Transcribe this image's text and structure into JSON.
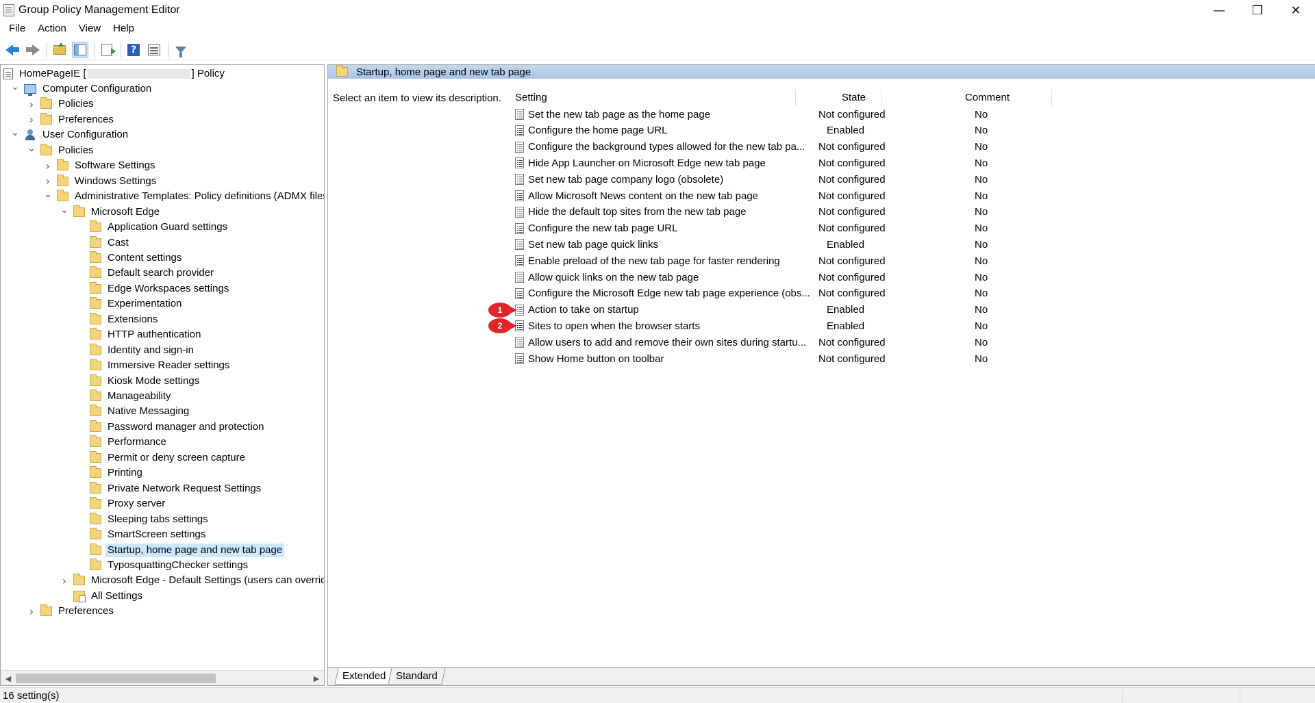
{
  "window": {
    "title": "Group Policy Management Editor",
    "controls": {
      "minimize": "—",
      "restore": "❐",
      "close": "✕"
    }
  },
  "menu": [
    "File",
    "Action",
    "View",
    "Help"
  ],
  "toolbar": {
    "icons": [
      "back-arrow-icon",
      "forward-arrow-icon",
      "up-folder-icon",
      "show-hide-tree-icon",
      "export-list-icon",
      "help-icon",
      "view-icon",
      "filter-icon"
    ],
    "help_glyph": "?"
  },
  "tree": {
    "root": {
      "prefix": "HomePageIE [",
      "suffix": "] Policy"
    },
    "items": [
      {
        "label": "Computer Configuration",
        "depth": 0,
        "expander": "open",
        "icon": "computer"
      },
      {
        "label": "Policies",
        "depth": 1,
        "expander": "closed",
        "icon": "folder"
      },
      {
        "label": "Preferences",
        "depth": 1,
        "expander": "closed",
        "icon": "folder"
      },
      {
        "label": "User Configuration",
        "depth": 0,
        "expander": "open",
        "icon": "user"
      },
      {
        "label": "Policies",
        "depth": 1,
        "expander": "open",
        "icon": "folder"
      },
      {
        "label": "Software Settings",
        "depth": 2,
        "expander": "closed",
        "icon": "folder"
      },
      {
        "label": "Windows Settings",
        "depth": 2,
        "expander": "closed",
        "icon": "folder"
      },
      {
        "label": "Administrative Templates: Policy definitions (ADMX files",
        "depth": 2,
        "expander": "open",
        "icon": "folder"
      },
      {
        "label": "Microsoft Edge",
        "depth": 3,
        "expander": "open",
        "icon": "folder"
      },
      {
        "label": "Application Guard settings",
        "depth": 4,
        "expander": "none",
        "icon": "folder"
      },
      {
        "label": "Cast",
        "depth": 4,
        "expander": "none",
        "icon": "folder"
      },
      {
        "label": "Content settings",
        "depth": 4,
        "expander": "none",
        "icon": "folder"
      },
      {
        "label": "Default search provider",
        "depth": 4,
        "expander": "none",
        "icon": "folder"
      },
      {
        "label": "Edge Workspaces settings",
        "depth": 4,
        "expander": "none",
        "icon": "folder"
      },
      {
        "label": "Experimentation",
        "depth": 4,
        "expander": "none",
        "icon": "folder"
      },
      {
        "label": "Extensions",
        "depth": 4,
        "expander": "none",
        "icon": "folder"
      },
      {
        "label": "HTTP authentication",
        "depth": 4,
        "expander": "none",
        "icon": "folder"
      },
      {
        "label": "Identity and sign-in",
        "depth": 4,
        "expander": "none",
        "icon": "folder"
      },
      {
        "label": "Immersive Reader settings",
        "depth": 4,
        "expander": "none",
        "icon": "folder"
      },
      {
        "label": "Kiosk Mode settings",
        "depth": 4,
        "expander": "none",
        "icon": "folder"
      },
      {
        "label": "Manageability",
        "depth": 4,
        "expander": "none",
        "icon": "folder"
      },
      {
        "label": "Native Messaging",
        "depth": 4,
        "expander": "none",
        "icon": "folder"
      },
      {
        "label": "Password manager and protection",
        "depth": 4,
        "expander": "none",
        "icon": "folder"
      },
      {
        "label": "Performance",
        "depth": 4,
        "expander": "none",
        "icon": "folder"
      },
      {
        "label": "Permit or deny screen capture",
        "depth": 4,
        "expander": "none",
        "icon": "folder"
      },
      {
        "label": "Printing",
        "depth": 4,
        "expander": "none",
        "icon": "folder"
      },
      {
        "label": "Private Network Request Settings",
        "depth": 4,
        "expander": "none",
        "icon": "folder"
      },
      {
        "label": "Proxy server",
        "depth": 4,
        "expander": "none",
        "icon": "folder"
      },
      {
        "label": "Sleeping tabs settings",
        "depth": 4,
        "expander": "none",
        "icon": "folder"
      },
      {
        "label": "SmartScreen settings",
        "depth": 4,
        "expander": "none",
        "icon": "folder"
      },
      {
        "label": "Startup, home page and new tab page",
        "depth": 4,
        "expander": "none",
        "icon": "folder",
        "selected": true
      },
      {
        "label": "TyposquattingChecker settings",
        "depth": 4,
        "expander": "none",
        "icon": "folder"
      },
      {
        "label": "Microsoft Edge - Default Settings (users can override",
        "depth": 3,
        "expander": "closed",
        "icon": "folder"
      },
      {
        "label": "All Settings",
        "depth": 3,
        "expander": "none",
        "icon": "allsettings"
      },
      {
        "label": "Preferences",
        "depth": 1,
        "expander": "closed",
        "icon": "folder"
      }
    ]
  },
  "details": {
    "header": "Startup, home page and new tab page",
    "description": "Select an item to view its description.",
    "columns": {
      "setting": "Setting",
      "state": "State",
      "comment": "Comment"
    },
    "rows": [
      {
        "setting": "Set the new tab page as the home page",
        "state": "Not configured",
        "comment": "No"
      },
      {
        "setting": "Configure the home page URL",
        "state": "Enabled",
        "comment": "No"
      },
      {
        "setting": "Configure the background types allowed for the new tab pa...",
        "state": "Not configured",
        "comment": "No"
      },
      {
        "setting": "Hide App Launcher on Microsoft Edge new tab page",
        "state": "Not configured",
        "comment": "No"
      },
      {
        "setting": "Set new tab page company logo (obsolete)",
        "state": "Not configured",
        "comment": "No"
      },
      {
        "setting": "Allow Microsoft News content on the new tab page",
        "state": "Not configured",
        "comment": "No"
      },
      {
        "setting": "Hide the default top sites from the new tab page",
        "state": "Not configured",
        "comment": "No"
      },
      {
        "setting": "Configure the new tab page URL",
        "state": "Not configured",
        "comment": "No"
      },
      {
        "setting": "Set new tab page quick links",
        "state": "Enabled",
        "comment": "No"
      },
      {
        "setting": "Enable preload of the new tab page for faster rendering",
        "state": "Not configured",
        "comment": "No"
      },
      {
        "setting": "Allow quick links on the new tab page",
        "state": "Not configured",
        "comment": "No"
      },
      {
        "setting": "Configure the Microsoft Edge new tab page experience (obs...",
        "state": "Not configured",
        "comment": "No"
      },
      {
        "setting": "Action to take on startup",
        "state": "Enabled",
        "comment": "No",
        "badge": "1"
      },
      {
        "setting": "Sites to open when the browser starts",
        "state": "Enabled",
        "comment": "No",
        "badge": "2"
      },
      {
        "setting": "Allow users to add and remove their own sites during startu...",
        "state": "Not configured",
        "comment": "No"
      },
      {
        "setting": "Show Home button on toolbar",
        "state": "Not configured",
        "comment": "No"
      }
    ],
    "tabs": [
      "Extended",
      "Standard"
    ],
    "active_tab": "Extended"
  },
  "status": {
    "text": "16 setting(s)"
  },
  "colors": {
    "badge": "#e0262a",
    "selection": "#cce8ff",
    "header": "#a9c5e6"
  }
}
